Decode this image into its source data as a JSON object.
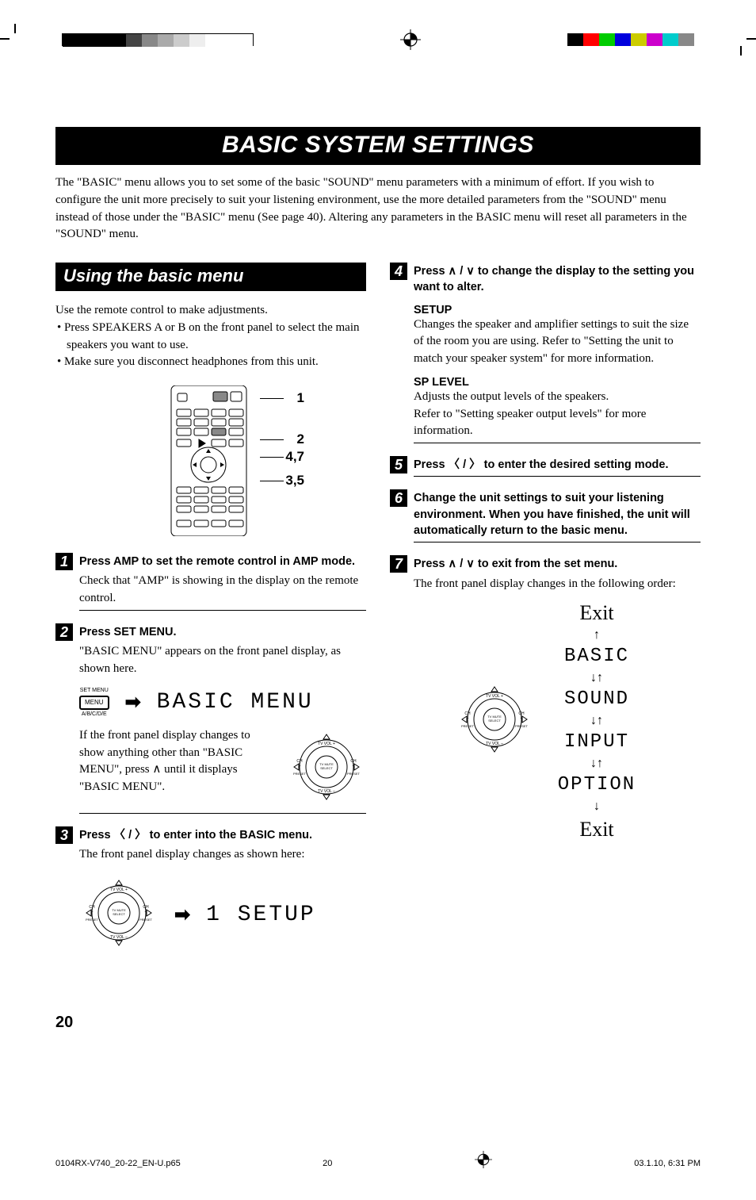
{
  "print_marks": {
    "color_bars_left": [
      "#000000",
      "#000000",
      "#000000",
      "#000000",
      "#444444",
      "#888888",
      "#aaaaaa",
      "#cccccc",
      "#eeeeee",
      "#ffffff",
      "#ffffff",
      "#ffffff"
    ],
    "color_bars_right": [
      "#000000",
      "#ff0000",
      "#00cc00",
      "#0000dd",
      "#cccc00",
      "#cc00cc",
      "#00cccc",
      "#888888"
    ]
  },
  "page_title": "BASIC SYSTEM SETTINGS",
  "intro": "The \"BASIC\" menu allows you to set some of the basic \"SOUND\" menu parameters with a minimum of effort. If you wish to configure the unit more precisely to suit your listening environment, use the more detailed parameters from the \"SOUND\" menu instead of those under the \"BASIC\" menu (See page 40). Altering any parameters in the BASIC menu will reset all parameters in the \"SOUND\" menu.",
  "left": {
    "section_title": "Using the basic menu",
    "p1": "Use the remote control to make adjustments.",
    "bullets": [
      "Press SPEAKERS A or B on the front panel to select the main speakers you want to use.",
      "Make sure you disconnect headphones from this unit."
    ],
    "remote_callouts": [
      "1",
      "2",
      "4,7",
      "3,5"
    ],
    "step1": {
      "num": "1",
      "head": "Press AMP to set the remote control in AMP mode.",
      "sub": "Check that \"AMP\" is showing in the display on the remote control."
    },
    "step2": {
      "num": "2",
      "head": "Press SET MENU.",
      "sub": "\"BASIC MENU\" appears on the front panel display, as shown here."
    },
    "menu_btn": {
      "top_label": "SET MENU",
      "btn_text": "MENU",
      "bottom_label": "A/B/C/D/E"
    },
    "lcd_basic_menu": "BASIC MENU",
    "note": "If the front panel display changes to show anything other than \"BASIC MENU\", press ∧ until it displays \"BASIC MENU\".",
    "step3": {
      "num": "3",
      "head": "Press 〈 / 〉 to enter into the BASIC menu.",
      "sub": "The front panel display changes as shown here:"
    },
    "lcd_setup": "1 SETUP"
  },
  "right": {
    "step4": {
      "num": "4",
      "head_prefix": "Press ",
      "head_suffix": " to change the display to the setting you want to alter."
    },
    "setup": {
      "name": "SETUP",
      "body": "Changes the speaker and amplifier settings to suit the size of the room you are using. Refer to \"Setting the unit to match your speaker system\" for more information."
    },
    "splevel": {
      "name": "SP LEVEL",
      "body1": "Adjusts the output levels of the speakers.",
      "body2": "Refer to \"Setting speaker output levels\" for more information."
    },
    "step5": {
      "num": "5",
      "head_prefix": "Press ",
      "head_suffix": " to enter the desired setting mode."
    },
    "step6": {
      "num": "6",
      "head": "Change the unit settings to suit your listening environment. When you have finished, the unit will automatically return to the basic menu."
    },
    "step7": {
      "num": "7",
      "head_prefix": "Press ",
      "head_suffix": " to exit from the set menu.",
      "sub": "The front panel display changes in the following order:"
    },
    "tree": {
      "exit_top": "Exit",
      "items": [
        "BASIC",
        "SOUND",
        "INPUT",
        "OPTION"
      ],
      "exit_bottom": "Exit"
    }
  },
  "navpad_labels": {
    "tv_vol_plus": "TV VOL +",
    "tv_vol_minus": "TV VOL –",
    "ch_minus": "CH –",
    "ch_plus": "CH +",
    "preset": "PRESET",
    "center": "TV MUTE\nSELECT"
  },
  "page_number": "20",
  "footer": {
    "file": "0104RX-V740_20-22_EN-U.p65",
    "page": "20",
    "date": "03.1.10, 6:31 PM"
  }
}
